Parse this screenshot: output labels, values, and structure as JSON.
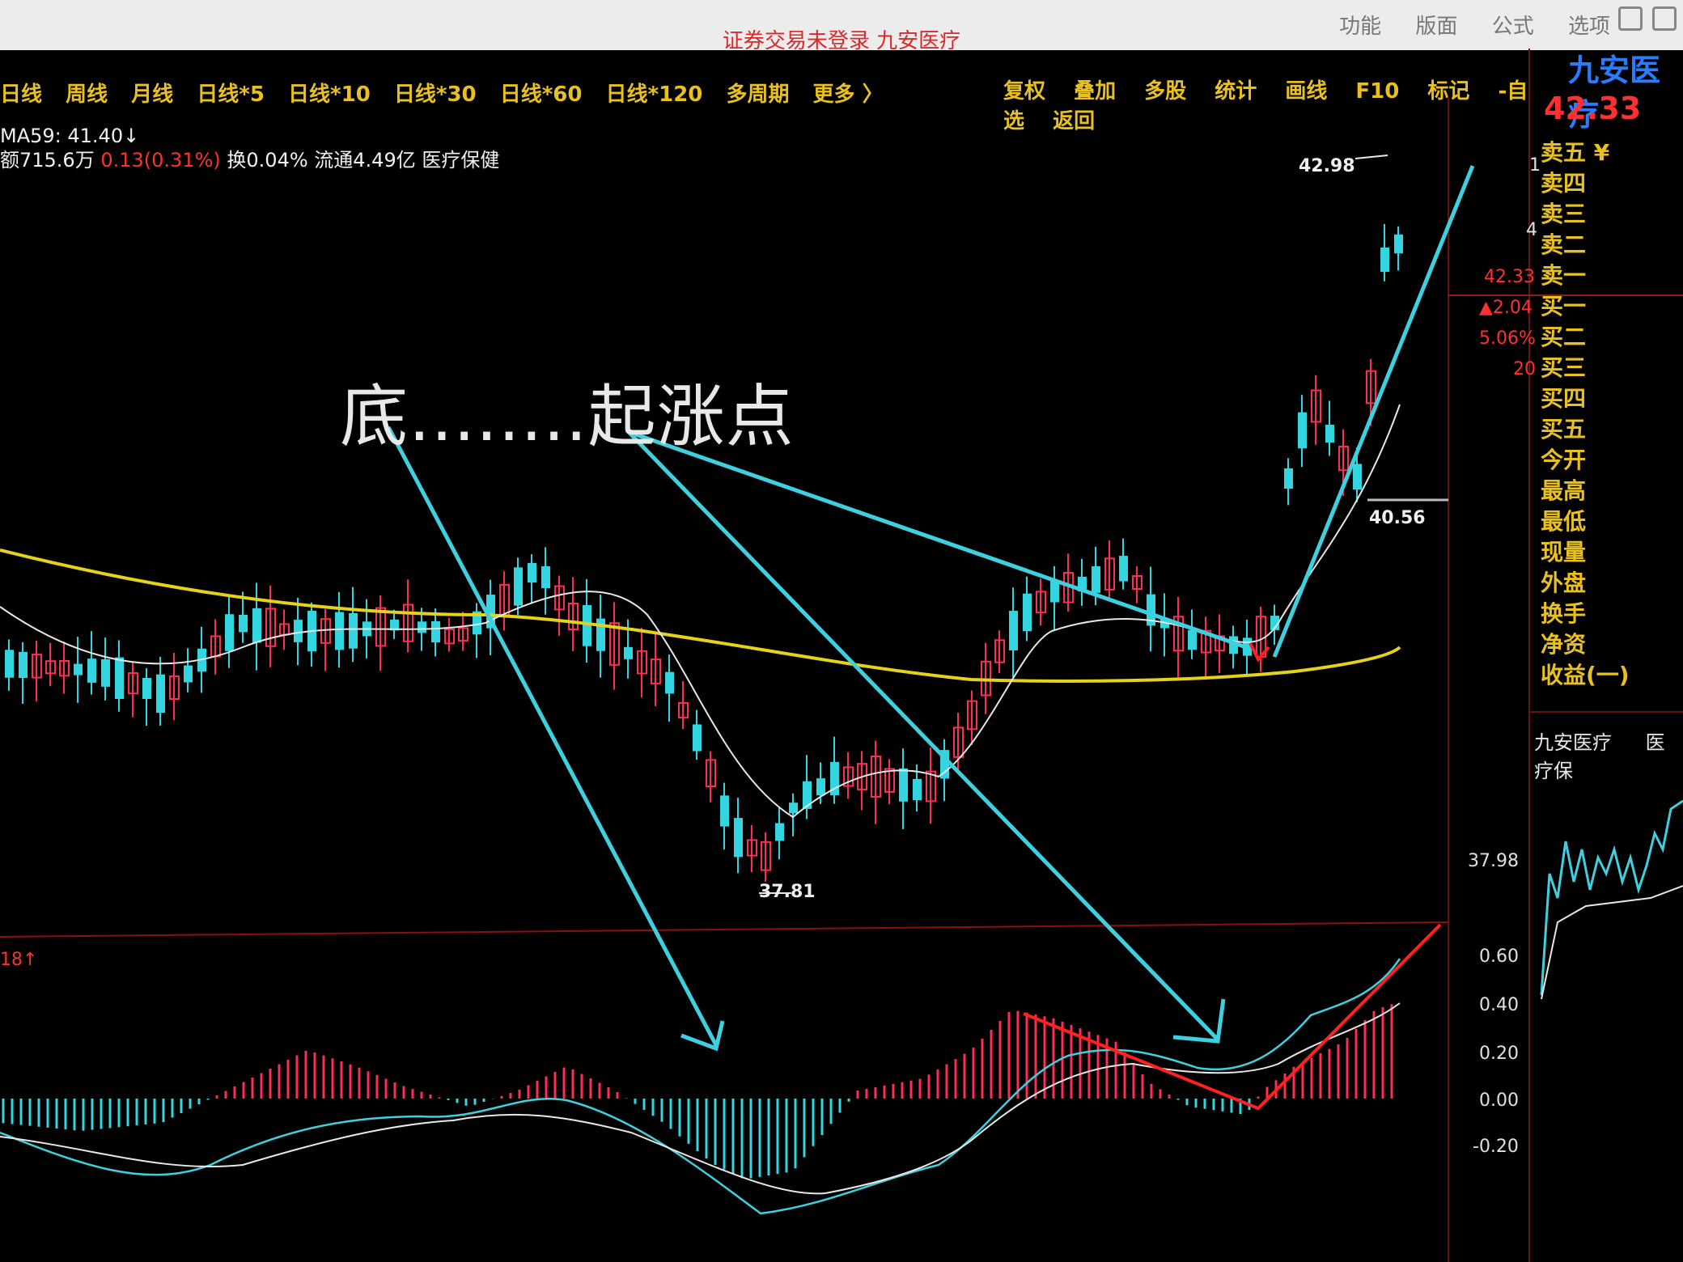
{
  "titlebar": {
    "status": "证券交易未登录  九安医疗",
    "menu": [
      "功能",
      "版面",
      "公式",
      "选项"
    ]
  },
  "toolbar": {
    "periods": [
      "日线",
      "周线",
      "月线",
      "日线*5",
      "日线*10",
      "日线*30",
      "日线*60",
      "日线*120",
      "多周期",
      "更多 〉"
    ],
    "tools": [
      "复权",
      "叠加",
      "多股",
      "统计",
      "画线",
      "F10",
      "标记",
      "-自选",
      "返回"
    ]
  },
  "info": {
    "ma": "MA59: 41.40↓",
    "amount": "额715.6万",
    "change": "0.13(0.31%)",
    "turnover": "换0.04% 流通4.49亿 医疗保健"
  },
  "annotation": "底........起涨点",
  "price_labels": {
    "high": "42.98",
    "low": "37.81",
    "last": "40.56"
  },
  "axis": {
    "right_prices": [
      "1",
      "4",
      "42.33",
      "▲2.04",
      "5.06%",
      "20",
      "37.98"
    ],
    "macd_ticks": [
      "0.60",
      "0.40",
      "0.20",
      "0.00",
      "-0.20"
    ],
    "macd_left": "18↑"
  },
  "side": {
    "title": "九安医疗",
    "price": "42.33",
    "quote_labels": [
      "卖五 ¥",
      "卖四",
      "卖三",
      "卖二",
      "卖一",
      "买一",
      "买二",
      "买三",
      "买四",
      "买五",
      "今开",
      "最高",
      "最低",
      "现量",
      "外盘",
      "换手",
      "净资",
      "收益(一)"
    ],
    "footer": [
      "九安医疗",
      "医疗保"
    ]
  },
  "colors": {
    "up": "#ff2d55",
    "down": "#33d6e0",
    "ma_long": "#e6d21a",
    "ma_short": "#e8e8e8",
    "annotation_arrow": "#3fd0e0",
    "red_mark": "#ff2020"
  }
}
